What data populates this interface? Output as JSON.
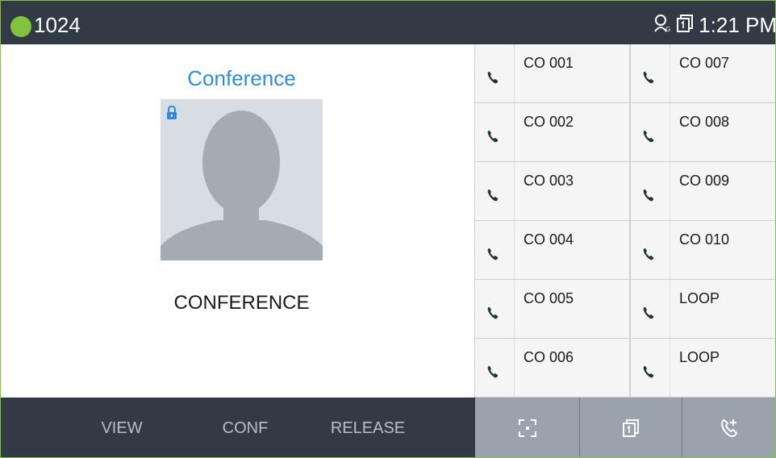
{
  "status": {
    "extension": "1024",
    "time": "1:21 PM",
    "icons": [
      "presence-dot",
      "globe-user-icon",
      "page-icon"
    ],
    "colors": {
      "bar": "#323a45",
      "presence": "#7fc43a"
    }
  },
  "call": {
    "title": "Conference",
    "name": "CONFERENCE",
    "title_color": "#2a8de3"
  },
  "lines": [
    {
      "label": "CO 001"
    },
    {
      "label": "CO 007"
    },
    {
      "label": "CO 002"
    },
    {
      "label": "CO 008"
    },
    {
      "label": "CO 003"
    },
    {
      "label": "CO 009"
    },
    {
      "label": "CO 004"
    },
    {
      "label": "CO 010"
    },
    {
      "label": "CO 005"
    },
    {
      "label": "LOOP"
    },
    {
      "label": "CO 006"
    },
    {
      "label": "LOOP"
    }
  ],
  "softkeys": {
    "view": "VIEW",
    "conf": "CONF",
    "release": "RELEASE"
  },
  "actions": [
    "expand-icon",
    "page-icon",
    "call-add-icon"
  ]
}
